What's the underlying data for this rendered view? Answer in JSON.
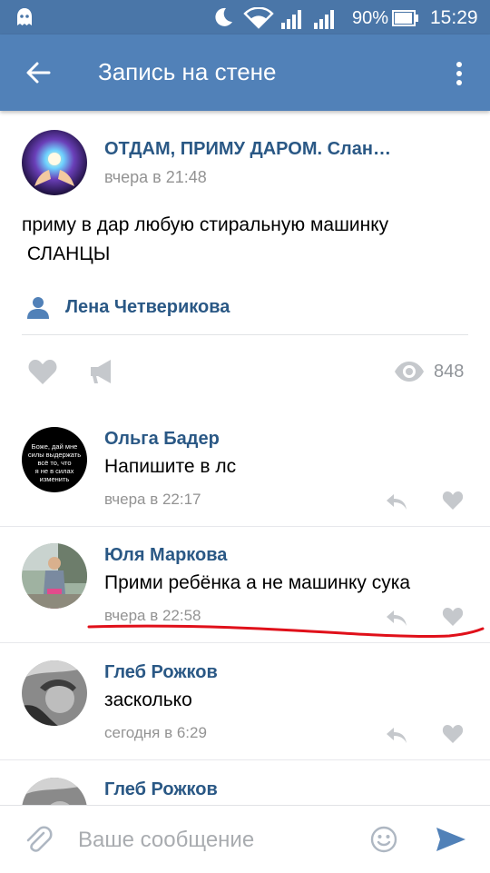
{
  "status_bar": {
    "battery": "90%",
    "time": "15:29"
  },
  "header": {
    "title": "Запись на стене"
  },
  "post": {
    "group_name": "ОТДАМ, ПРИМУ ДАРОМ. Слан…",
    "time": "вчера в 21:48",
    "text_line1": "приму в дар любую стиральную машинку",
    "text_line2": " СЛАНЦЫ",
    "author": "Лена Четверикова",
    "views": "848"
  },
  "comments": [
    {
      "name": "Ольга Бадер",
      "text": "Напишите в лс",
      "time": "вчера в 22:17",
      "avatar_text": "Боже, дай мне силы выдержать всё то, что я не в силах изменить"
    },
    {
      "name": "Юля Маркова",
      "text": "Прими ребёнка а не машинку сука",
      "time": "вчера в 22:58"
    },
    {
      "name": "Глеб Рожков",
      "text": "засколько",
      "time": "сегодня в 6:29"
    },
    {
      "name": "Глеб Рожков"
    }
  ],
  "composer": {
    "placeholder": "Ваше сообщение"
  },
  "colors": {
    "status_bar": "#4a76a8",
    "header": "#5181b8",
    "link": "#2a5885",
    "muted": "#939393",
    "annotation": "#e0101a"
  },
  "icons": [
    "ghost-icon",
    "moon-icon",
    "wifi-icon",
    "signal-icon",
    "battery-icon",
    "back-arrow-icon",
    "more-vertical-icon",
    "person-icon",
    "heart-icon",
    "megaphone-icon",
    "eye-icon",
    "reply-icon",
    "paperclip-icon",
    "smile-icon",
    "send-icon"
  ]
}
